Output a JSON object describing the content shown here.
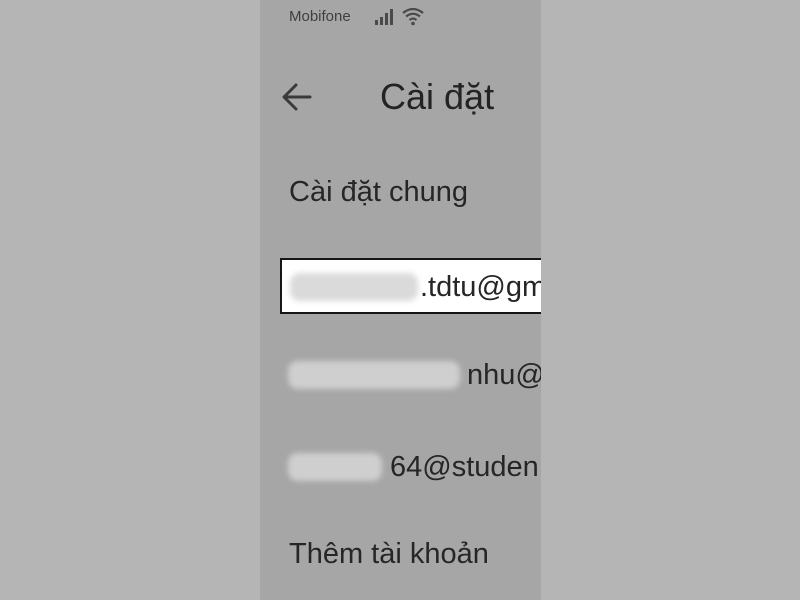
{
  "status_bar": {
    "carrier": "Mobifone",
    "signal_icon": "signal-bars-icon",
    "wifi_icon": "wifi-icon"
  },
  "app_bar": {
    "back_icon": "arrow-left-icon",
    "title": "Cài đặt"
  },
  "menu": {
    "general_settings": "Cài đặt chung",
    "add_account": "Thêm tài khoản"
  },
  "accounts": [
    {
      "visible_text": ".tdtu@gm",
      "selected": true
    },
    {
      "visible_text": "nhu@",
      "selected": false
    },
    {
      "visible_text": "64@studen",
      "selected": false
    }
  ],
  "colors": {
    "outer_background": "#b5b5b5",
    "screen_background": "#a6a6a6",
    "selected_background": "#ffffff",
    "selected_border": "#161616",
    "text": "#262626"
  }
}
